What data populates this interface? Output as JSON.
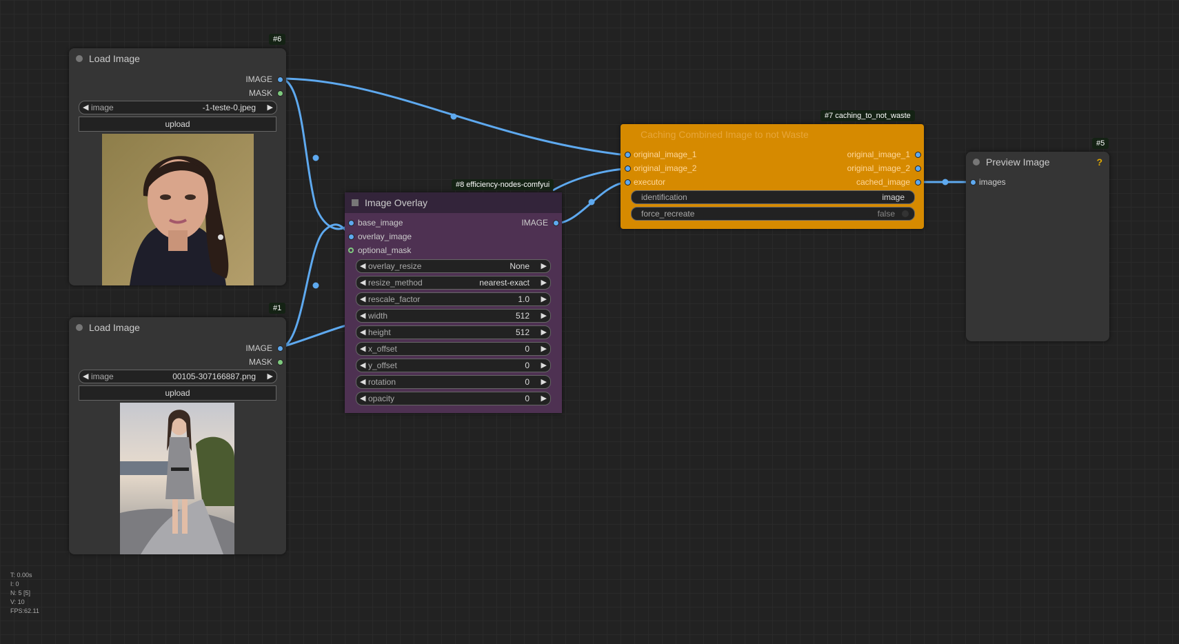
{
  "nodes": {
    "load1": {
      "id": "#6",
      "title": "Load Image",
      "outputs": [
        "IMAGE",
        "MASK"
      ],
      "widget_label": "image",
      "widget_value": "-1-teste-0.jpeg",
      "upload": "upload",
      "preview": "woman-portrait"
    },
    "load2": {
      "id": "#1",
      "title": "Load Image",
      "outputs": [
        "IMAGE",
        "MASK"
      ],
      "widget_label": "image",
      "widget_value": "00105-307166887.png",
      "upload": "upload",
      "preview": "woman-walking-outdoors"
    },
    "overlay": {
      "badge": "#8 efficiency-nodes-comfyui",
      "title": "Image Overlay",
      "inputs": [
        "base_image",
        "overlay_image",
        "optional_mask"
      ],
      "output": "IMAGE",
      "widgets": [
        {
          "label": "overlay_resize",
          "value": "None"
        },
        {
          "label": "resize_method",
          "value": "nearest-exact"
        },
        {
          "label": "rescale_factor",
          "value": "1.0"
        },
        {
          "label": "width",
          "value": "512"
        },
        {
          "label": "height",
          "value": "512"
        },
        {
          "label": "x_offset",
          "value": "0"
        },
        {
          "label": "y_offset",
          "value": "0"
        },
        {
          "label": "rotation",
          "value": "0"
        },
        {
          "label": "opacity",
          "value": "0"
        }
      ]
    },
    "caching": {
      "badge": "#7 caching_to_not_waste",
      "title": "Caching Combined Image to not Waste",
      "inputs": [
        "original_image_1",
        "original_image_2",
        "executor"
      ],
      "outputs": [
        "original_image_1",
        "original_image_2",
        "cached_image"
      ],
      "widgets": [
        {
          "label": "identification",
          "value": "image"
        },
        {
          "label": "force_recreate",
          "value": "false"
        }
      ]
    },
    "preview": {
      "id": "#5",
      "title": "Preview Image",
      "help": "?",
      "input": "images"
    }
  },
  "stats": [
    "T: 0.00s",
    "I: 0",
    "N: 5 [5]",
    "V: 10",
    "FPS:62.11"
  ],
  "colors": {
    "canvas_bg": "#222222",
    "node_bg": "#353535",
    "overlay_bg": "#4e3152",
    "overlay_title": "#33243a",
    "caching_bg": "#d68a00",
    "link_image": "#5ea9ef",
    "mask_slot": "#7fca7f"
  }
}
